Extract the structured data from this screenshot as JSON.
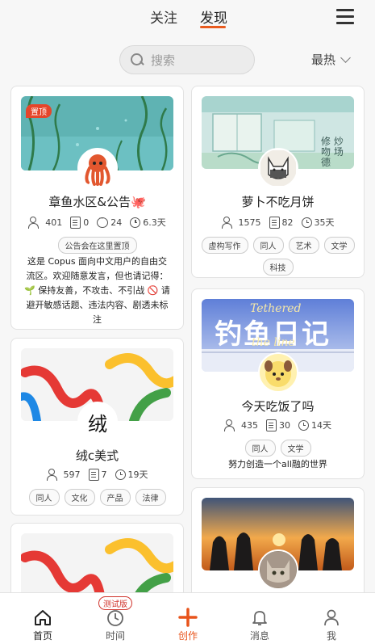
{
  "header": {
    "tabs": [
      {
        "label": "关注"
      },
      {
        "label": "发现"
      }
    ],
    "active_tab": "发现"
  },
  "search": {
    "placeholder": "搜索"
  },
  "sort": {
    "label": "最热"
  },
  "cards": [
    {
      "title": "章鱼水区&公告🐙",
      "pinned_label": "置顶",
      "stats": {
        "members": "401",
        "posts": "0",
        "comments": "24",
        "age": "6.3天"
      },
      "tags": [
        "公告会在这里置顶"
      ],
      "description": "这是 Copus 面向中文用户的自由交流区。欢迎随意发言，但也请记得：🌱 保持友善，不攻击、不引战 🚫 请避开敏感话题、违法内容、剧透未标注"
    },
    {
      "title": "萝卜不吃月饼",
      "stats": {
        "members": "1575",
        "posts": "82",
        "age": "35天"
      },
      "tags": [
        "虚构写作",
        "同人",
        "艺术",
        "文学",
        "科技"
      ]
    },
    {
      "title": "绒c美式",
      "avatar_char": "绒",
      "stats": {
        "members": "597",
        "posts": "7",
        "age": "19天"
      },
      "tags": [
        "同人",
        "文化",
        "产品",
        "法律"
      ]
    },
    {
      "title": "今天吃饭了吗",
      "banner_text": "钓鱼日记",
      "banner_text2": "Tethered",
      "banner_text3": "the line",
      "stats": {
        "members": "435",
        "posts": "30",
        "age": "14天"
      },
      "tags": [
        "同人",
        "文学"
      ],
      "description": "努力创造一个all融的世界"
    }
  ],
  "banner_marks": {
    "card2_text": "修 炒 吻 场德"
  },
  "bottom_nav": [
    {
      "label": "首页"
    },
    {
      "label": "时间",
      "badge": "测试版"
    },
    {
      "label": "创作"
    },
    {
      "label": "消息"
    },
    {
      "label": "我"
    }
  ],
  "colors": {
    "accent": "#e8541b",
    "pin": "#e5452a"
  }
}
